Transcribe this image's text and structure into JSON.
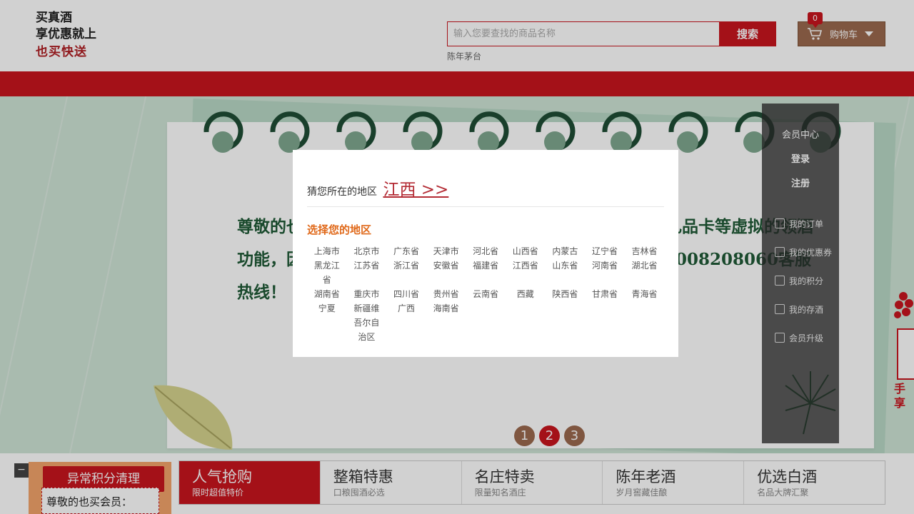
{
  "header": {
    "logo_line1": "买真酒",
    "logo_line2": "享优惠就上",
    "logo_line3": "也买快送",
    "search_placeholder": "输入您要查找的商品名称",
    "search_button": "搜索",
    "hot_word": "陈年茅台",
    "cart_label": "购物车",
    "cart_count": "0"
  },
  "banner": {
    "notice": "尊敬的也买会员：也买快送。自5月27日起，不限于积分、礼品卡等虚拟的领酒功能，因此带来购买商品，体验更多服务：如有疑问请拨打4008208060客服热线！",
    "pager": [
      "1",
      "2",
      "3"
    ],
    "pager_active": "2"
  },
  "member": {
    "title": "会员中心",
    "login": "登录",
    "register": "注册",
    "items": [
      "我的订单",
      "我的优惠券",
      "我的积分",
      "我的存酒",
      "会员升级"
    ]
  },
  "edge": {
    "text1": "手",
    "text2": "享"
  },
  "bottom": {
    "points_ribbon": "异常积分清理",
    "points_text": "尊敬的也买会员：",
    "tabs": [
      {
        "title": "人气抢购",
        "sub": "限时超值特价"
      },
      {
        "title": "整箱特惠",
        "sub": "口粮囤酒必选"
      },
      {
        "title": "名庄特卖",
        "sub": "限量知名酒庄"
      },
      {
        "title": "陈年老酒",
        "sub": "岁月窖藏佳酿"
      },
      {
        "title": "优选白酒",
        "sub": "名品大牌汇聚"
      }
    ]
  },
  "modal": {
    "guess_label": "猜您所在的地区",
    "guess_region": "江西 >>",
    "choose_label": "选择您的地区",
    "regions": [
      "上海市",
      "北京市",
      "广东省",
      "天津市",
      "河北省",
      "山西省",
      "内蒙古",
      "辽宁省",
      "吉林省",
      "黑龙江省",
      "江苏省",
      "浙江省",
      "安徽省",
      "福建省",
      "江西省",
      "山东省",
      "河南省",
      "湖北省",
      "湖南省",
      "重庆市",
      "四川省",
      "贵州省",
      "云南省",
      "西藏",
      "陕西省",
      "甘肃省",
      "青海省",
      "宁夏",
      "新疆维吾尔自治区",
      "广西",
      "海南省"
    ]
  },
  "colors": {
    "brand_red": "#c9151e",
    "cart_brown": "#9b6a4f",
    "notice_green": "#1f5a36",
    "choose_orange": "#e0691a"
  }
}
